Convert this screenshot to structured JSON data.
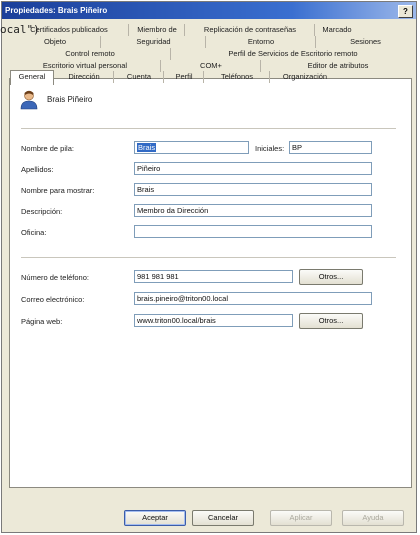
{
  "stray_overlay_text": "ocal\")",
  "window": {
    "title": "Propiedades: Brais Piñeiro",
    "help_label": "?"
  },
  "tabs": {
    "row1": [
      "Certificados publicados",
      "Miembro de",
      "Replicación de contraseñas",
      "Marcado"
    ],
    "row2": [
      "Objeto",
      "Seguridad",
      "Entorno",
      "Sesiones"
    ],
    "row3": [
      "Control remoto",
      "Perfil de Servicios de Escritorio remoto"
    ],
    "row4": [
      "Escritorio virtual personal",
      "COM+",
      "Editor de atributos"
    ],
    "row5": [
      "General",
      "Dirección",
      "Cuenta",
      "Perfil",
      "Teléfonos",
      "Organización"
    ],
    "active": "General"
  },
  "general": {
    "user_display_name": "Brais Piñeiro",
    "first_name_label": "Nombre de pila:",
    "first_name_value": "Brais",
    "initials_label": "Iniciales:",
    "initials_value": "BP",
    "last_name_label": "Apellidos:",
    "last_name_value": "Piñeiro",
    "display_name_label": "Nombre para mostrar:",
    "display_name_value": "Brais",
    "description_label": "Descripción:",
    "description_value": "Membro da Dirección",
    "office_label": "Oficina:",
    "office_value": "",
    "phone_label": "Número de teléfono:",
    "phone_value": "981 981 981",
    "email_label": "Correo electrónico:",
    "email_value": "brais.pineiro@triton00.local",
    "web_label": "Página web:",
    "web_value": "www.triton00.local/brais",
    "others_label": "Otros..."
  },
  "buttons": {
    "ok": "Aceptar",
    "cancel": "Cancelar",
    "apply": "Aplicar",
    "help": "Ayuda"
  },
  "colors": {
    "titlebar": "#1b3f9a",
    "selection": "#316ac5",
    "dialog": "#ece9d8"
  },
  "icons": [
    "user-icon"
  ]
}
